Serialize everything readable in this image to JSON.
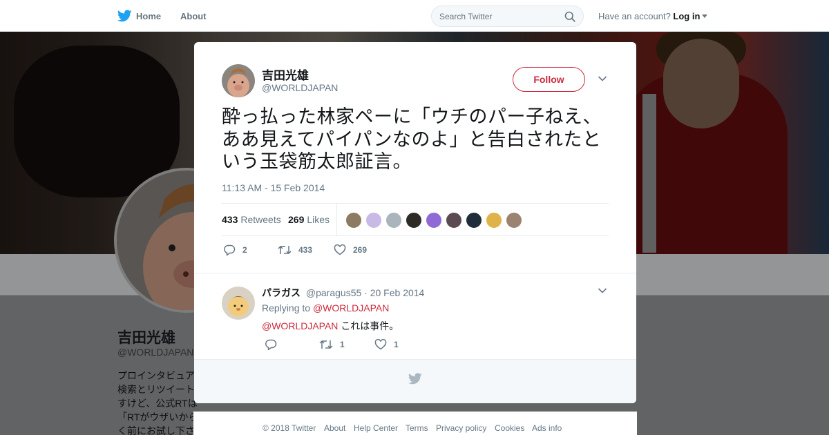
{
  "nav": {
    "home": "Home",
    "about": "About",
    "search_placeholder": "Search Twitter",
    "have_account": "Have an account?",
    "login": "Log in"
  },
  "profile": {
    "name": "吉田光雄",
    "handle": "@WORLDJAPAN",
    "bio": "プロインタビュア\n検索とリツイート\nすけど、公式RTは\n「RTがウザいから\nく前にお試し下さ"
  },
  "tweet": {
    "author_name": "吉田光雄",
    "author_handle": "@WORLDJAPAN",
    "follow_label": "Follow",
    "text": "酔っ払った林家ペーに「ウチのパー子ねえ、ああ見えてパイパンなのよ」と告白されたという玉袋筋太郎証言。",
    "timestamp": "11:13 AM - 15 Feb 2014",
    "retweets_count": "433",
    "retweets_label": "Retweets",
    "likes_count": "269",
    "likes_label": "Likes",
    "reply_action_count": "2",
    "retweet_action_count": "433",
    "like_action_count": "269"
  },
  "reply": {
    "author_name": "パラガス",
    "author_handle": "@paragus55",
    "date": "· 20 Feb 2014",
    "replying_to_label": "Replying to",
    "replying_to_handle": "@WORLDJAPAN",
    "mention": "@WORLDJAPAN",
    "text": "これは事件。",
    "retweet_count": "1",
    "like_count": "1"
  },
  "footer": {
    "copyright": "© 2018 Twitter",
    "about": "About",
    "help": "Help Center",
    "terms": "Terms",
    "privacy": "Privacy policy",
    "cookies": "Cookies",
    "ads": "Ads info"
  },
  "colors": {
    "twitter_blue": "#1da1f2",
    "follow_red": "#cc2a3e",
    "muted_text": "#657786"
  },
  "icons": [
    "twitter-bird-icon",
    "search-icon",
    "close-icon",
    "chevron-down-icon",
    "reply-icon",
    "retweet-icon",
    "like-icon"
  ]
}
